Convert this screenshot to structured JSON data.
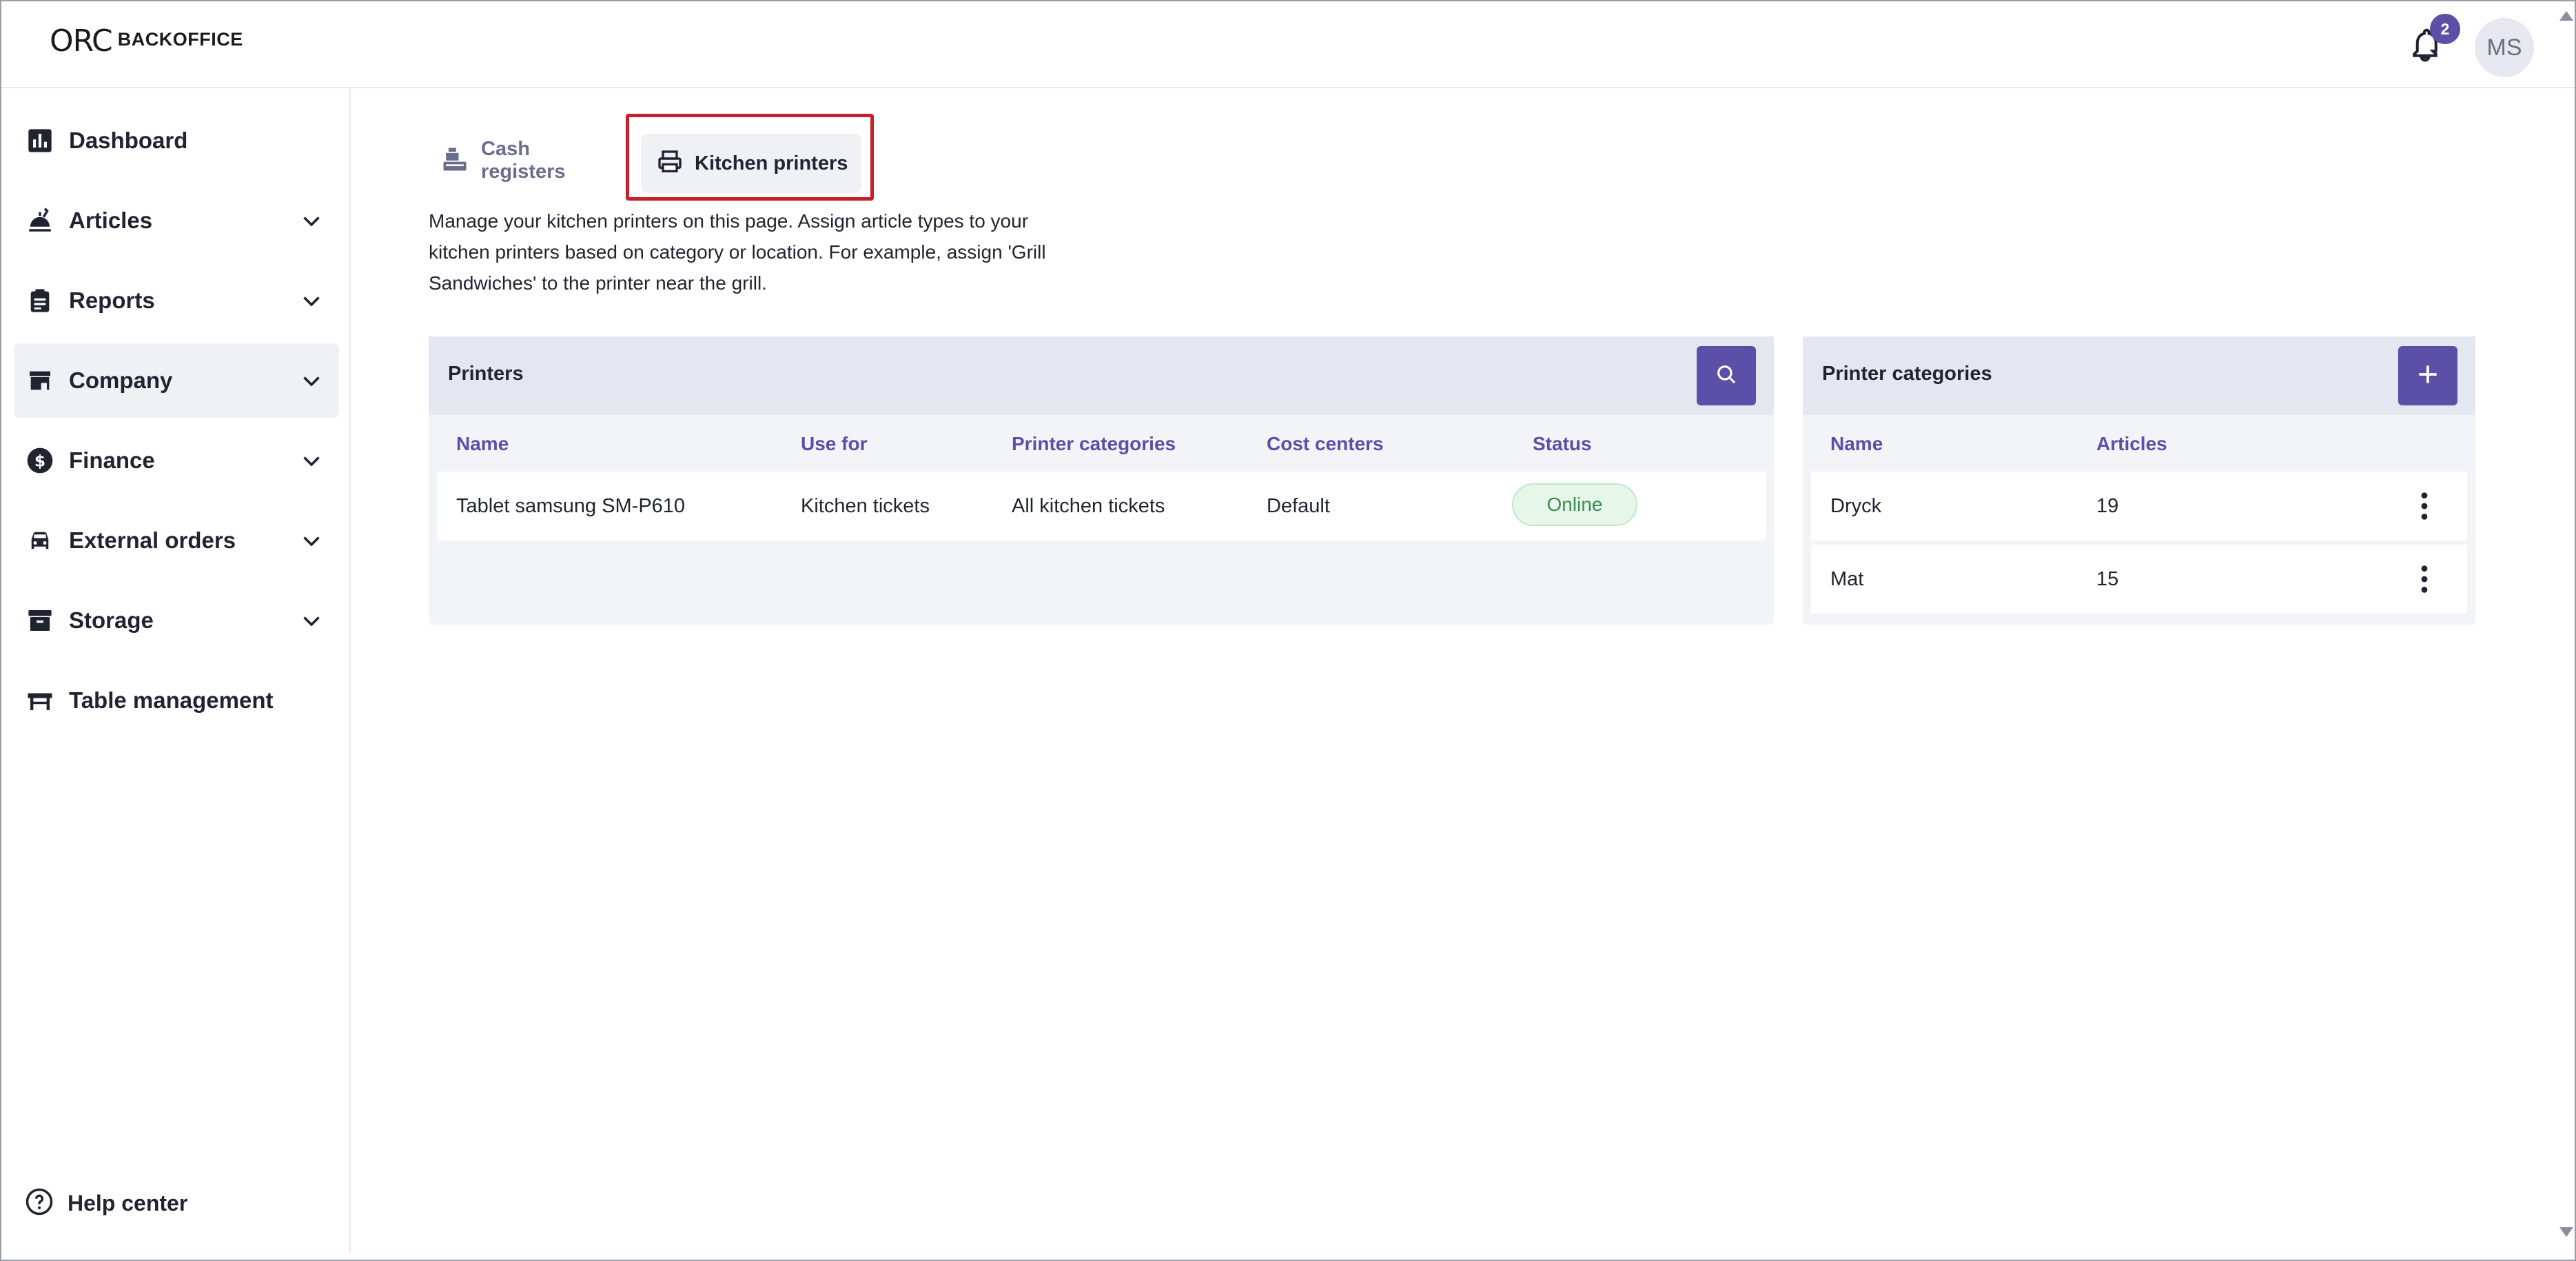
{
  "app": {
    "logo_mark": "ORC",
    "logo_word": "BACKOFFICE",
    "notifications_count": "2",
    "user_initials": "MS"
  },
  "sidebar": {
    "items": [
      {
        "label": "Dashboard",
        "icon": "bar-chart-icon",
        "expandable": false
      },
      {
        "label": "Articles",
        "icon": "food-icon",
        "expandable": true
      },
      {
        "label": "Reports",
        "icon": "clipboard-icon",
        "expandable": true
      },
      {
        "label": "Company",
        "icon": "store-icon",
        "expandable": true,
        "active": true
      },
      {
        "label": "Finance",
        "icon": "dollar-icon",
        "expandable": true
      },
      {
        "label": "External orders",
        "icon": "car-icon",
        "expandable": true
      },
      {
        "label": "Storage",
        "icon": "archive-icon",
        "expandable": true
      },
      {
        "label": "Table management",
        "icon": "table-icon",
        "expandable": false
      }
    ],
    "help_label": "Help center"
  },
  "tabs": [
    {
      "label": "Cash registers",
      "icon": "cash-register-icon"
    },
    {
      "label": "Kitchen printers",
      "icon": "printer-icon",
      "selected": true
    }
  ],
  "description": "Manage your kitchen printers on this page. Assign article types to your kitchen printers based on category or location. For example, assign 'Grill Sandwiches' to the printer near the grill.",
  "printers_panel": {
    "title": "Printers",
    "columns": [
      "Name",
      "Use for",
      "Printer categories",
      "Cost centers",
      "Status"
    ],
    "rows": [
      {
        "name": "Tablet samsung SM-P610",
        "use_for": "Kitchen tickets",
        "categories": "All kitchen tickets",
        "cost_centers": "Default",
        "status": "Online"
      }
    ]
  },
  "categories_panel": {
    "title": "Printer categories",
    "columns": [
      "Name",
      "Articles"
    ],
    "rows": [
      {
        "name": "Dryck",
        "articles": "19"
      },
      {
        "name": "Mat",
        "articles": "15"
      }
    ]
  },
  "colors": {
    "accent": "#5b4fa8",
    "highlight": "#c8202a",
    "online": "#3f8a4f"
  }
}
